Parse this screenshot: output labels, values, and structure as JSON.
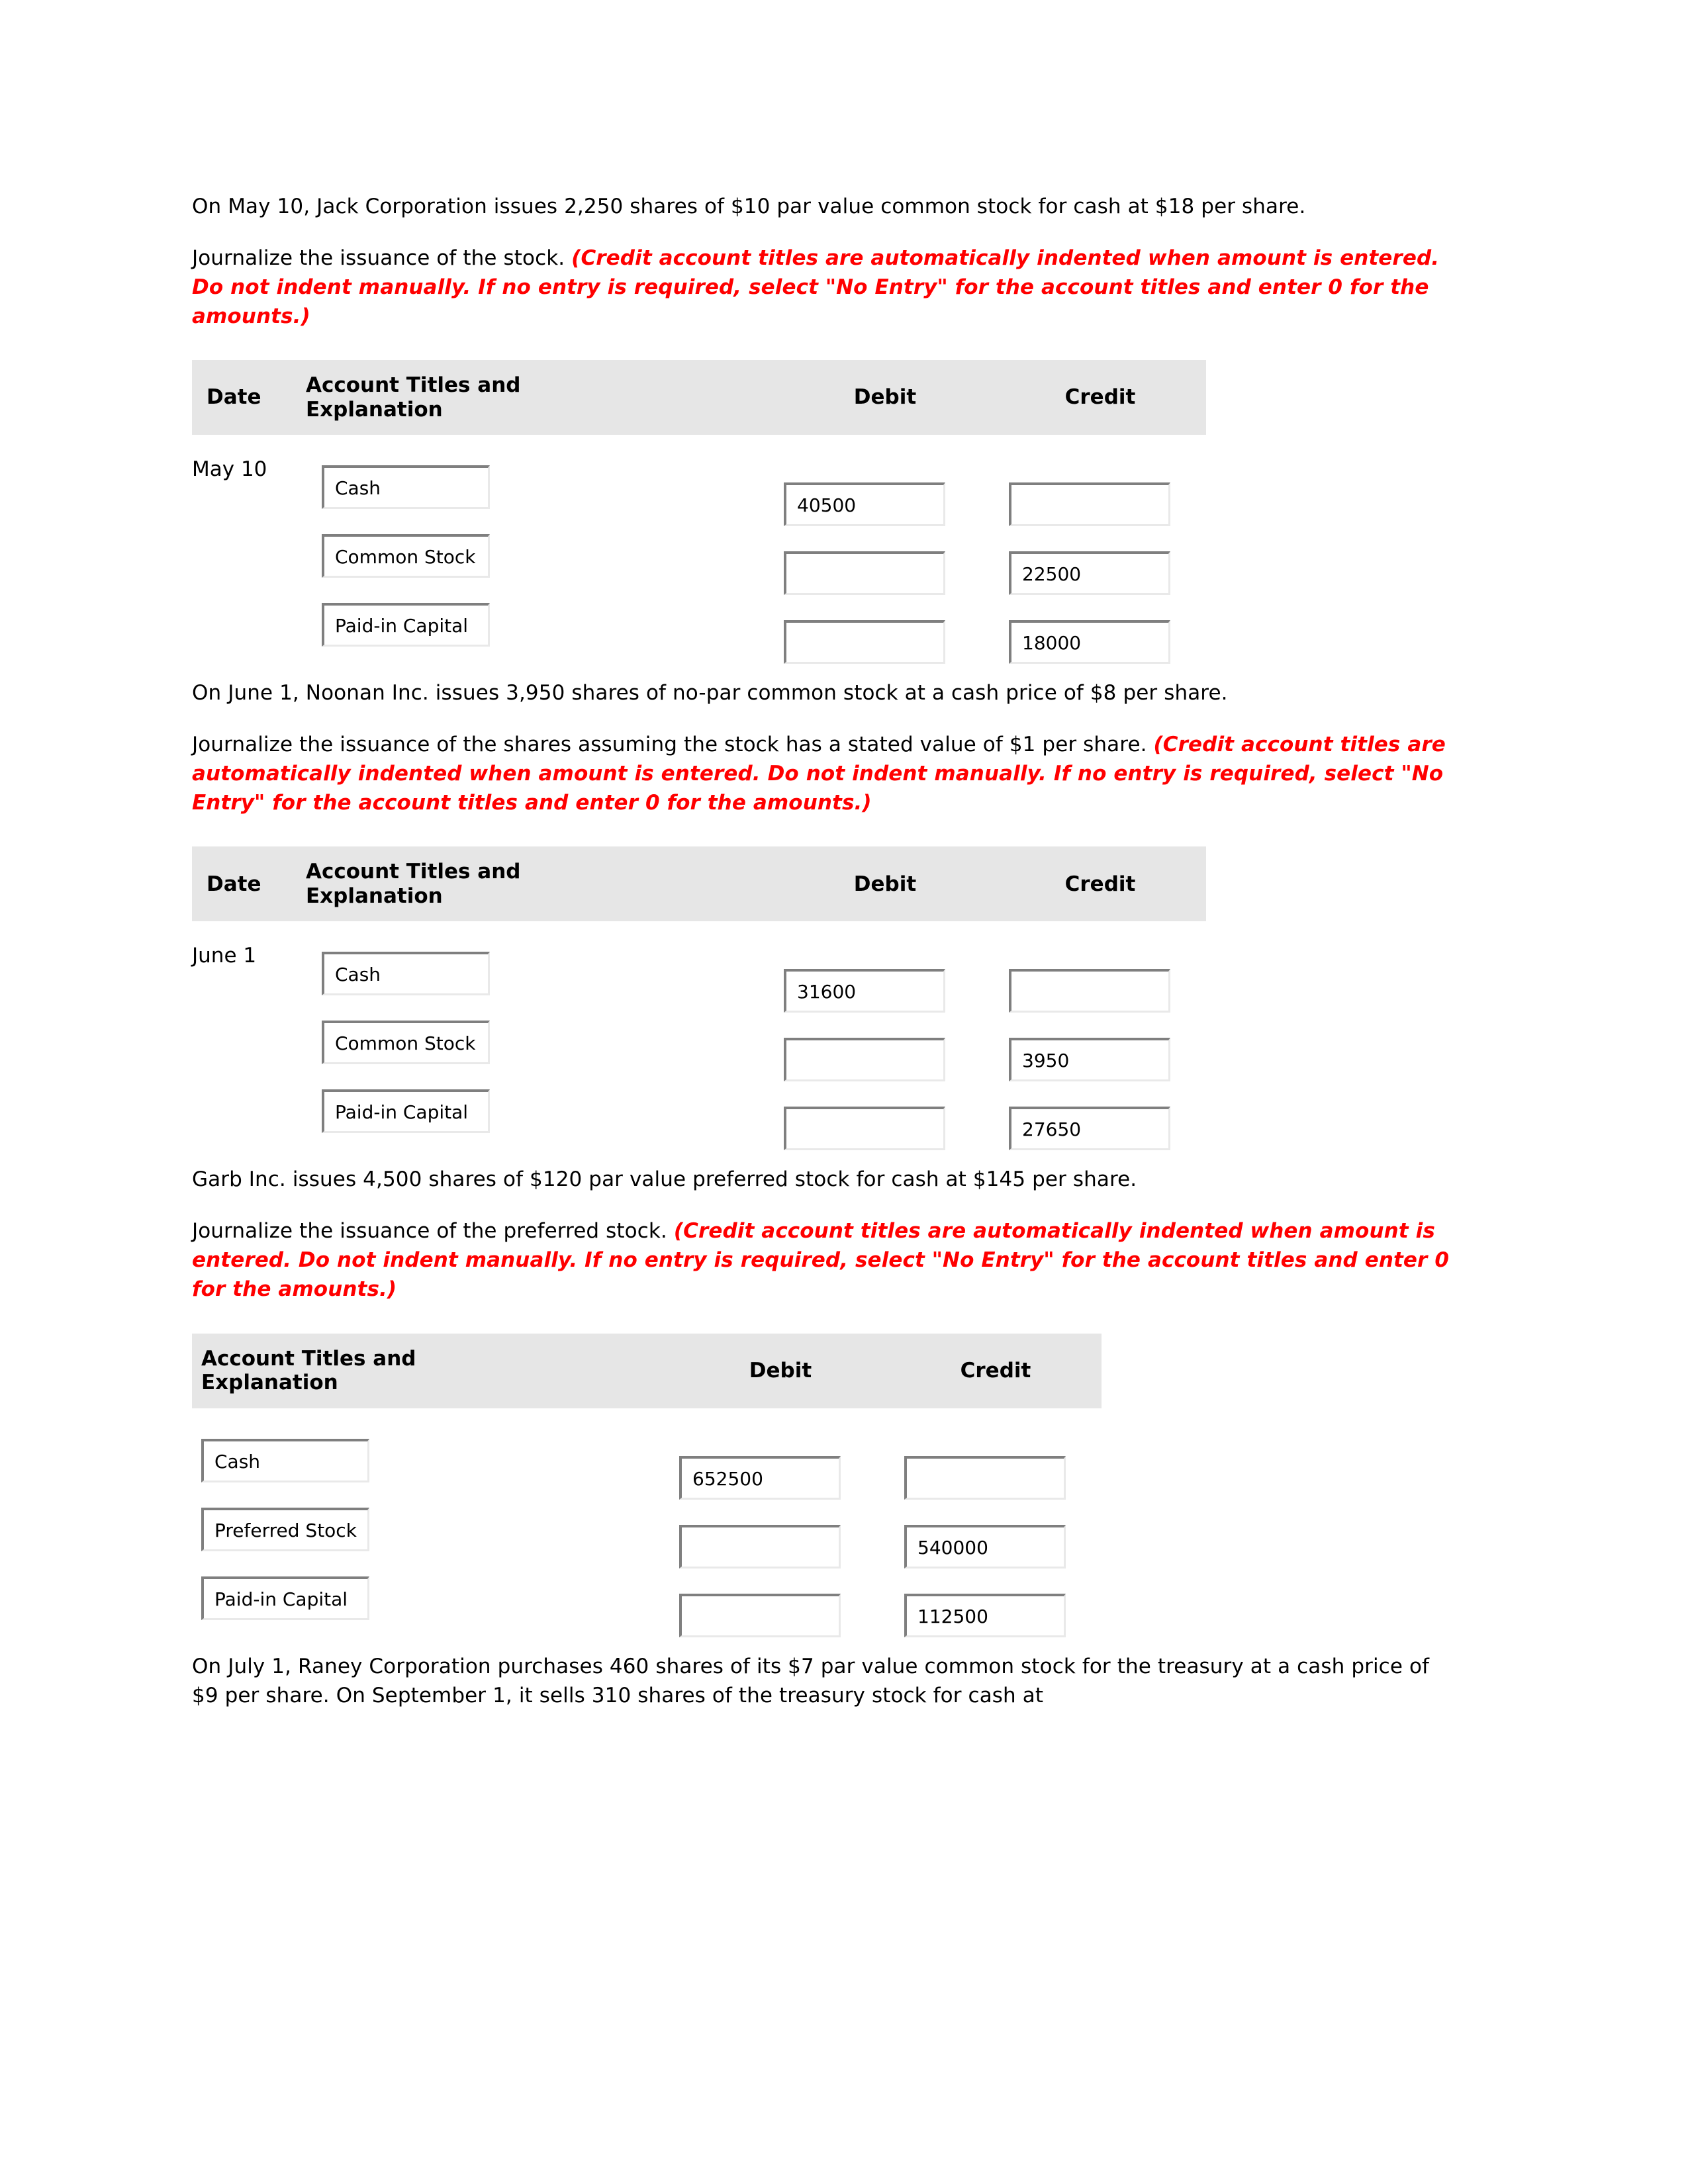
{
  "problems": [
    {
      "id": "p1",
      "prompt": "On May 10, Jack Corporation issues 2,250 shares of $10 par value common stock for cash at $18 per share.",
      "instruction_plain": "Journalize the issuance of the stock. ",
      "instruction_note": "(Credit account titles are automatically indented when amount is entered. Do not indent manually. If no entry is required, select \"No Entry\" for the account titles and enter 0 for the amounts.)",
      "table": {
        "has_date_column": true,
        "headers": {
          "date": "Date",
          "account": "Account Titles and Explanation",
          "debit": "Debit",
          "credit": "Credit"
        },
        "rows": [
          {
            "date": "May 10",
            "account": "Cash",
            "debit": "40500",
            "credit": ""
          },
          {
            "date": "",
            "account": "Common Stock",
            "debit": "",
            "credit": "22500"
          },
          {
            "date": "",
            "account": "Paid-in Capital",
            "debit": "",
            "credit": "18000"
          }
        ]
      }
    },
    {
      "id": "p2",
      "prompt": "On June 1, Noonan Inc. issues 3,950 shares of no-par common stock at a cash price of $8 per share.",
      "instruction_plain": "Journalize the issuance of the shares assuming the stock has a stated value of $1 per share. ",
      "instruction_note": "(Credit account titles are automatically indented when amount is entered. Do not indent manually. If no entry is required, select \"No Entry\" for the account titles and enter 0 for the amounts.)",
      "table": {
        "has_date_column": true,
        "headers": {
          "date": "Date",
          "account": "Account Titles and Explanation",
          "debit": "Debit",
          "credit": "Credit"
        },
        "rows": [
          {
            "date": "June 1",
            "account": "Cash",
            "debit": "31600",
            "credit": ""
          },
          {
            "date": "",
            "account": "Common Stock",
            "debit": "",
            "credit": "3950"
          },
          {
            "date": "",
            "account": "Paid-in Capital",
            "debit": "",
            "credit": "27650"
          }
        ]
      }
    },
    {
      "id": "p3",
      "prompt": "Garb Inc. issues 4,500 shares of $120 par value preferred stock for cash at $145 per share.",
      "instruction_plain": "Journalize the issuance of the preferred stock. ",
      "instruction_note": "(Credit account titles are automatically indented when amount is entered. Do not indent manually. If no entry is required, select \"No Entry\" for the account titles and enter 0 for the amounts.)",
      "table": {
        "has_date_column": false,
        "headers": {
          "date": "",
          "account": "Account Titles and Explanation",
          "debit": "Debit",
          "credit": "Credit"
        },
        "rows": [
          {
            "date": "",
            "account": "Cash",
            "debit": "652500",
            "credit": ""
          },
          {
            "date": "",
            "account": "Preferred Stock",
            "debit": "",
            "credit": "540000"
          },
          {
            "date": "",
            "account": "Paid-in Capital",
            "debit": "",
            "credit": "112500"
          }
        ]
      }
    }
  ],
  "footer": {
    "prompt": "On July 1, Raney Corporation purchases 460 shares of its $7 par value common stock for the treasury at a cash price of $9 per share. On September 1, it sells 310 shares of the treasury stock for cash at"
  },
  "colors": {
    "header_bg": "#e6e6e6",
    "note_red": "#ff0000",
    "field_border_dark": "#7f7f7f",
    "field_border_light": "#e9e9e9",
    "text": "#000000"
  }
}
